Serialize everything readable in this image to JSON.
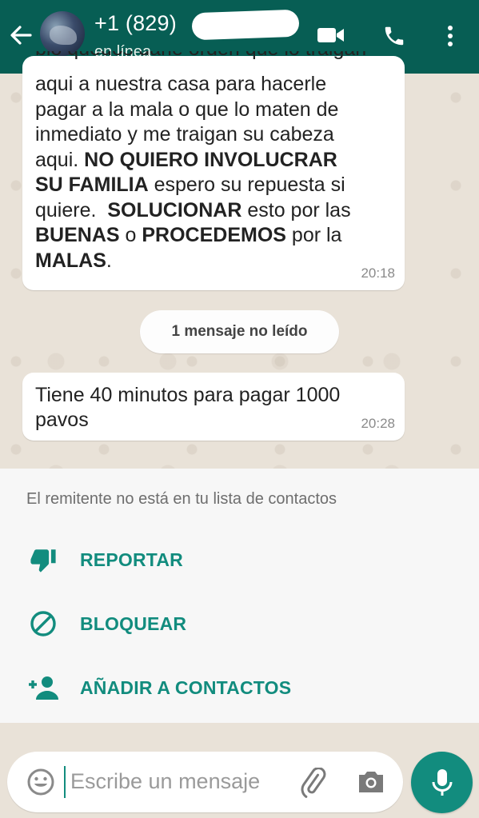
{
  "header": {
    "title": "+1 (829)",
    "status": "en línea",
    "background": "#075e54"
  },
  "messages": [
    {
      "partial_line": "bio quedos darle orden que lo traigan",
      "segments": [
        [
          {
            "t": "aqui a nuestra casa para hacerle",
            "b": false
          }
        ],
        [
          {
            "t": "pagar a la mala o que lo maten de",
            "b": false
          }
        ],
        [
          {
            "t": "inmediato y me traigan su cabeza",
            "b": false
          }
        ],
        [
          {
            "t": "aqui. ",
            "b": false
          },
          {
            "t": "NO QUIERO INVOLUCRAR",
            "b": true
          }
        ],
        [
          {
            "t": "SU FAMILIA",
            "b": true
          },
          {
            "t": " espero su repuesta si",
            "b": false
          }
        ],
        [
          {
            "t": "quiere.  ",
            "b": false
          },
          {
            "t": "SOLUCIONAR",
            "b": true
          },
          {
            "t": " esto por las",
            "b": false
          }
        ],
        [
          {
            "t": "BUENAS",
            "b": true
          },
          {
            "t": " o ",
            "b": false
          },
          {
            "t": "PROCEDEMOS",
            "b": true
          },
          {
            "t": " por la",
            "b": false
          }
        ],
        [
          {
            "t": "MALAS",
            "b": true
          },
          {
            "t": ".",
            "b": false
          }
        ]
      ],
      "time": "20:18"
    },
    {
      "text": "Tiene 40 minutos para pagar 1000\npavos",
      "time": "20:28"
    }
  ],
  "unread_banner": "1 mensaje no leído",
  "panel": {
    "notice": "El remitente no está en tu lista de contactos",
    "actions": [
      {
        "label": "REPORTAR",
        "icon": "thumbs-down-icon"
      },
      {
        "label": "BLOQUEAR",
        "icon": "block-icon"
      },
      {
        "label": "AÑADIR A CONTACTOS",
        "icon": "add-person-icon"
      }
    ],
    "accent": "#128c7e"
  },
  "input": {
    "placeholder": "Escribe un mensaje"
  }
}
